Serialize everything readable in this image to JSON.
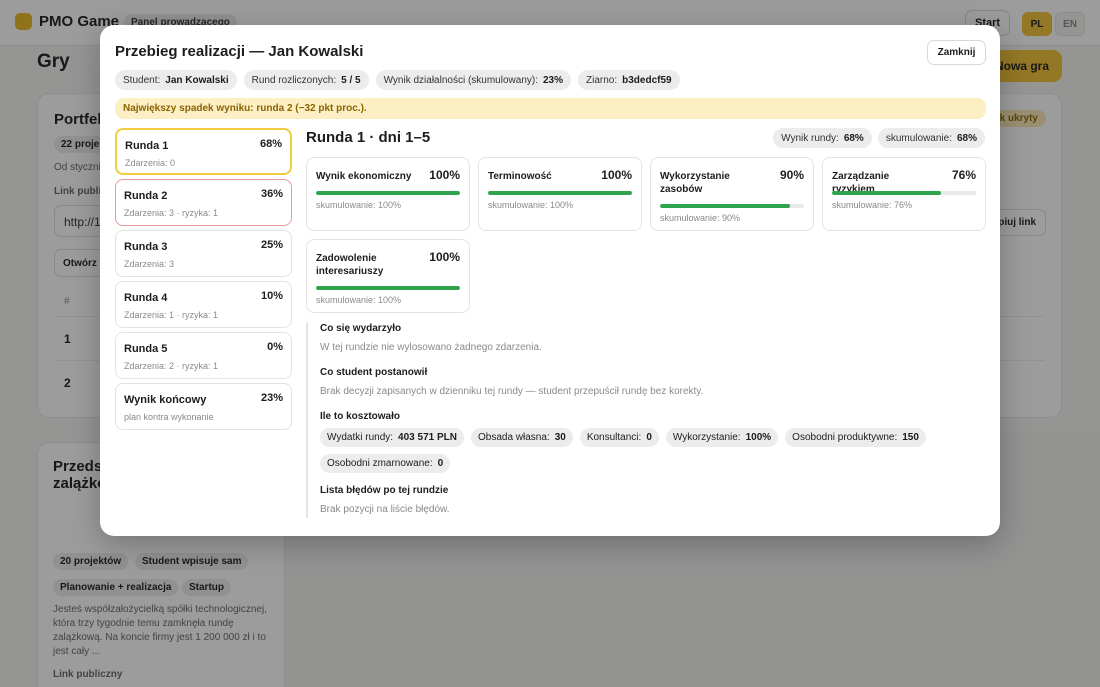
{
  "app": {
    "brand": "PMO Game",
    "panel_badge": "Panel prowadzącego",
    "start": "Start",
    "lang_pl": "PL",
    "lang_en": "EN",
    "page_title": "Gry",
    "new_game": "Nowa gra"
  },
  "bg_card1": {
    "title": "Portfel",
    "chip": "22 proje",
    "meta": "Od styczni",
    "link_label": "Link publi",
    "url": "http://1",
    "open": "Otwórz",
    "hidden_badge": "k ukryty",
    "copy": "Kopiuj link",
    "th": "#",
    "rows": [
      "1",
      "2"
    ]
  },
  "bg_card2": {
    "title": "Przeds perspe startup dni po zalążkowej",
    "chips": [
      "20 projektów",
      "Student wpisuje sam",
      "Planowanie + realizacja",
      "Startup"
    ],
    "desc": "Jesteś współzałożycielką spółki technologicznej, która trzy tygodnie temu zamknęła rundę zalążkową. Na koncie firmy jest 1 200 000 zł i to jest cały ...",
    "link_label": "Link publiczny"
  },
  "modal": {
    "title": "Przebieg realizacji — Jan Kowalski",
    "close": "Zamknij",
    "stats": [
      {
        "k": "Student:",
        "v": "Jan Kowalski"
      },
      {
        "k": "Rund rozliczonych:",
        "v": "5 / 5"
      },
      {
        "k": "Wynik działalności (skumulowany):",
        "v": "23%"
      },
      {
        "k": "Ziarno:",
        "v": "b3dedcf59"
      }
    ],
    "warning": "Największy spadek wyniku: runda 2 (−32 pkt proc.).",
    "rounds": [
      {
        "name": "Runda 1",
        "pct": "68%",
        "sub": "Zdarzenia: 0",
        "state": "active"
      },
      {
        "name": "Runda 2",
        "pct": "36%",
        "sub": "Zdarzenia: 3 · ryzyka: 1",
        "state": "bad"
      },
      {
        "name": "Runda 3",
        "pct": "25%",
        "sub": "Zdarzenia: 3",
        "state": ""
      },
      {
        "name": "Runda 4",
        "pct": "10%",
        "sub": "Zdarzenia: 1 · ryzyka: 1",
        "state": ""
      },
      {
        "name": "Runda 5",
        "pct": "0%",
        "sub": "Zdarzenia: 2 · ryzyka: 1",
        "state": ""
      },
      {
        "name": "Wynik końcowy",
        "pct": "23%",
        "sub": "plan kontra wykonanie",
        "state": ""
      }
    ],
    "detail": {
      "title": "Runda 1 · dni 1–5",
      "pills": [
        {
          "k": "Wynik rundy:",
          "v": "68%"
        },
        {
          "k": "skumulowanie:",
          "v": "68%"
        }
      ],
      "metrics": [
        {
          "name": "Wynik ekonomiczny",
          "value": "100%",
          "fill": 1.0,
          "cum": "skumulowanie: 100%"
        },
        {
          "name": "Terminowość",
          "value": "100%",
          "fill": 1.0,
          "cum": "skumulowanie: 100%"
        },
        {
          "name": "Wykorzystanie zasobów",
          "value": "90%",
          "fill": 0.9,
          "cum": "skumulowanie: 90%"
        },
        {
          "name": "Zarządzanie ryzykiem",
          "value": "76%",
          "fill": 0.76,
          "cum": "skumulowanie: 76%"
        },
        {
          "name": "Zadowolenie interesariuszy",
          "value": "100%",
          "fill": 1.0,
          "cum": "skumulowanie: 100%"
        }
      ],
      "what_happened_h": "Co się wydarzyło",
      "what_happened_t": "W tej rundzie nie wylosowano żadnego zdarzenia.",
      "decision_h": "Co student postanowił",
      "decision_t": "Brak decyzji zapisanych w dzienniku tej rundy — student przepuścił rundę bez korekty.",
      "cost_h": "Ile to kosztowało",
      "costs": [
        {
          "k": "Wydatki rundy:",
          "v": "403 571 PLN"
        },
        {
          "k": "Obsada własna:",
          "v": "30"
        },
        {
          "k": "Konsultanci:",
          "v": "0"
        },
        {
          "k": "Wykorzystanie:",
          "v": "100%"
        },
        {
          "k": "Osobodni produktywne:",
          "v": "150"
        },
        {
          "k": "Osobodni zmarnowane:",
          "v": "0"
        }
      ],
      "errors_h": "Lista błędów po tej rundzie",
      "errors_t": "Brak pozycji na liście błędów."
    }
  }
}
